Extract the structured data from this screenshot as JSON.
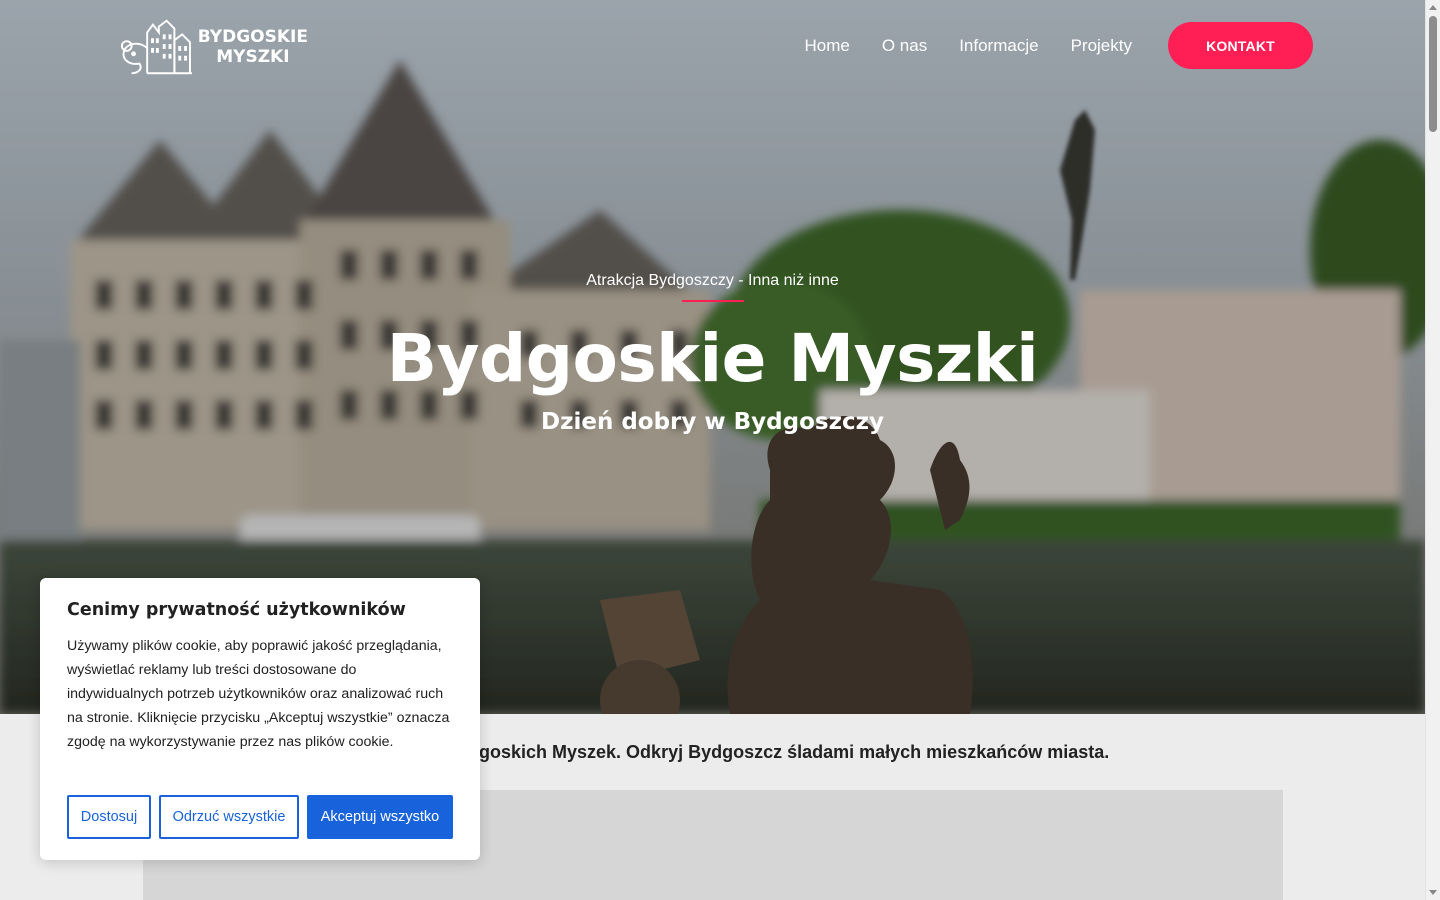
{
  "header": {
    "logo_line1": "BYDGOSKIE",
    "logo_line2": "MYSZKI",
    "nav": [
      "Home",
      "O nas",
      "Informacje",
      "Projekty"
    ],
    "contact_label": "KONTAKT",
    "accent_color": "#ff1f55"
  },
  "hero": {
    "kicker": "Atrakcja Bydgoszczy - Inna niż inne",
    "title": "Bydgoskie Myszki",
    "subtitle": "Dzień dobry w Bydgoszczy"
  },
  "intro": {
    "visible_text": "lgoskich Myszek. Odkryj Bydgoszcz śladami małych mieszkańców miasta."
  },
  "cookie": {
    "title": "Cenimy prywatność użytkowników",
    "text": "Używamy plików cookie, aby poprawić jakość przeglądania, wyświetlać reklamy lub treści dostosowane do indywidualnych potrzeb użytkowników oraz analizować ruch na stronie. Kliknięcie przycisku „Akceptuj wszystkie” oznacza zgodę na wykorzystywanie przez nas plików cookie.",
    "customize_label": "Dostosuj",
    "reject_label": "Odrzuć wszystkie",
    "accept_label": "Akceptuj wszystko",
    "button_color": "#1863dc"
  }
}
